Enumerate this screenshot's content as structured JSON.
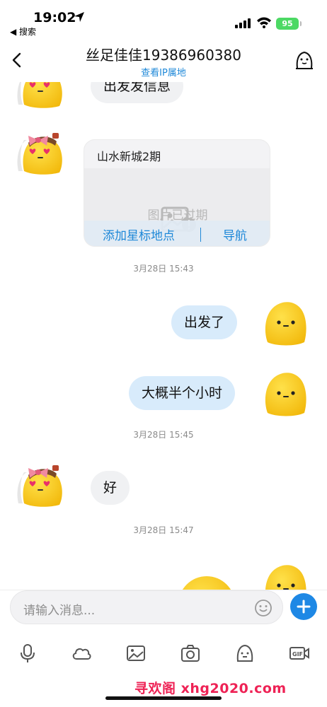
{
  "status_bar": {
    "time": "19:02",
    "back_app": "◀ 搜索",
    "battery": "95"
  },
  "nav": {
    "title": "丝足佳佳19386960380",
    "subtitle": "查看IP属地"
  },
  "messages": {
    "m1": "出发发信息",
    "location_card": {
      "title": "山水新城2期",
      "image_status": "图片已过期",
      "action_star": "添加星标地点",
      "action_nav": "导航"
    },
    "ts1": "3月28日 15:43",
    "m2": "出发了",
    "m3": "大概半个小时",
    "ts2": "3月28日 15:45",
    "m4": "好",
    "ts3": "3月28日 15:47"
  },
  "input": {
    "placeholder": "请输入消息..."
  },
  "toolbar": [
    "microphone-icon",
    "cloud-icon",
    "image-icon",
    "camera-icon",
    "sticker-icon",
    "gif-icon"
  ],
  "watermark": "寻欢阁 xhg2020.com",
  "colors": {
    "accent": "#1e88d8",
    "bubble_left": "#f0f1f3",
    "bubble_right": "#d8ebfb",
    "mochi_yellow": "#f7c51f"
  }
}
